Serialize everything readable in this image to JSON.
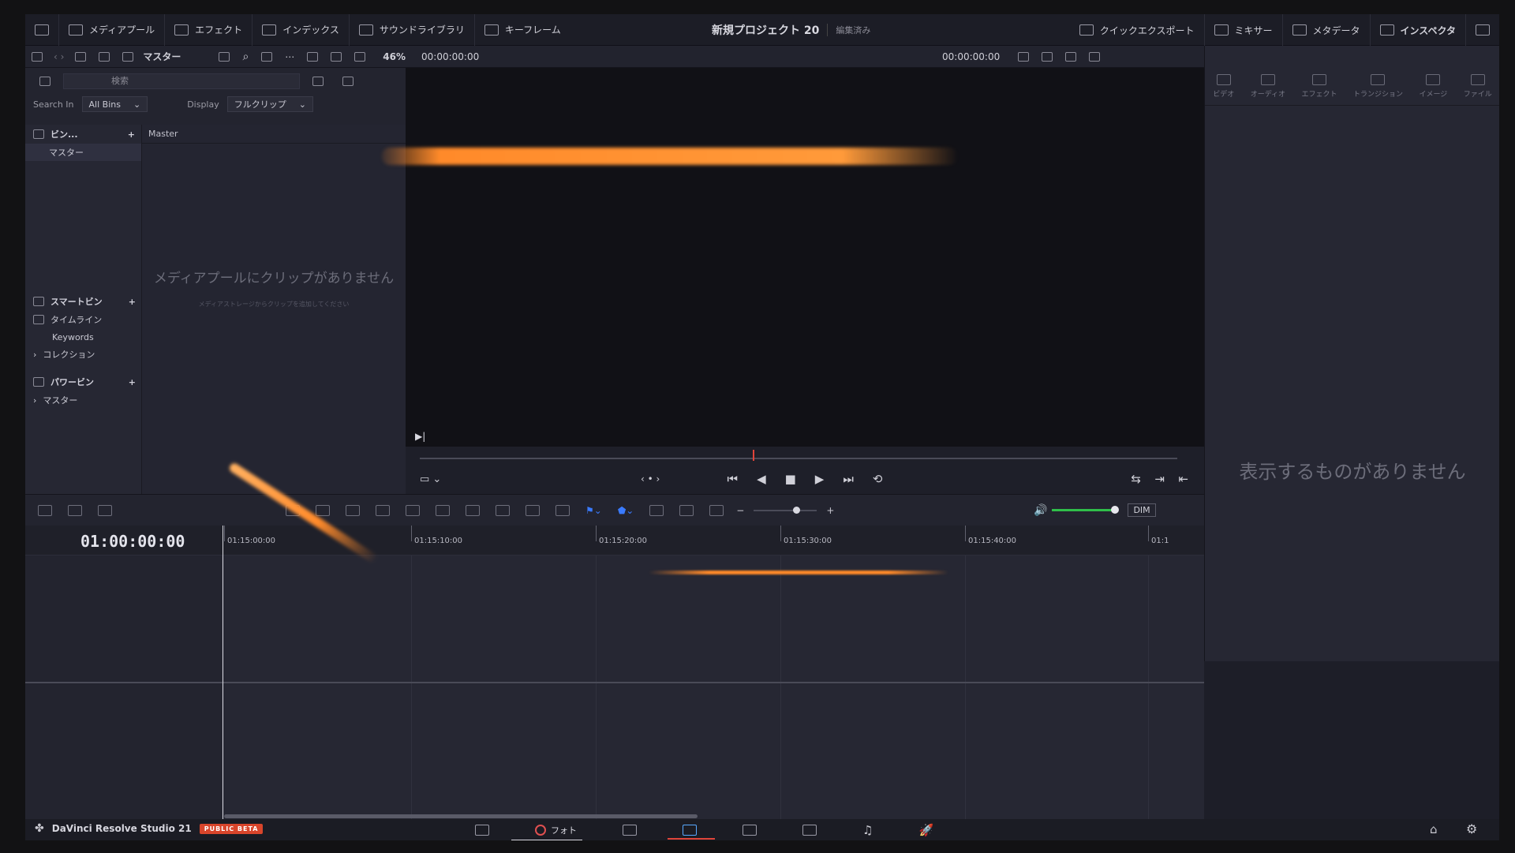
{
  "topbar": {
    "media_pool": "メディアプール",
    "effects": "エフェクト",
    "index": "インデックス",
    "sound_library": "サウンドライブラリ",
    "keyframes": "キーフレーム",
    "project_title": "新規プロジェクト 20",
    "project_status": "編集済み",
    "quick_export": "クイックエクスポート",
    "mixer": "ミキサー",
    "metadata": "メタデータ",
    "inspector": "インスペクタ"
  },
  "toolbar2": {
    "bin_name": "マスター",
    "zoom": "46%",
    "source_tc": "00:00:00:00",
    "record_tc": "00:00:00:00"
  },
  "media_pool": {
    "search_placeholder": "検索",
    "search_in_label": "Search In",
    "search_in_value": "All Bins",
    "display_label": "Display",
    "display_value": "フルクリップ",
    "bins_header": "ビン...",
    "master_bin": "マスター",
    "clip_header": "Master",
    "empty_main": "メディアプールにクリップがありません",
    "empty_sub": "メディアストレージからクリップを追加してください",
    "smart_bins": "スマートビン",
    "timeline_bin": "タイムライン",
    "keywords_bin": "Keywords",
    "collection_bin": "コレクション",
    "power_bins": "パワービン",
    "power_master": "マスター"
  },
  "inspector": {
    "tabs": [
      "ビデオ",
      "オーディオ",
      "エフェクト",
      "トランジション",
      "イメージ",
      "ファイル"
    ],
    "empty": "表示するものがありません"
  },
  "timeline": {
    "timecode": "01:00:00:00",
    "ticks": [
      "01:15:00:00",
      "01:15:10:00",
      "01:15:20:00",
      "01:15:30:00",
      "01:15:40:00",
      "01:1"
    ],
    "dim_label": "DIM"
  },
  "pagebar": {
    "brand": "DaVinci Resolve Studio 21",
    "beta": "PUBLIC BETA",
    "photo_label": "フォト"
  },
  "colors": {
    "accent_red": "#e0443a",
    "volume_green": "#2fbf4a",
    "beta_orange": "#d8452b"
  }
}
